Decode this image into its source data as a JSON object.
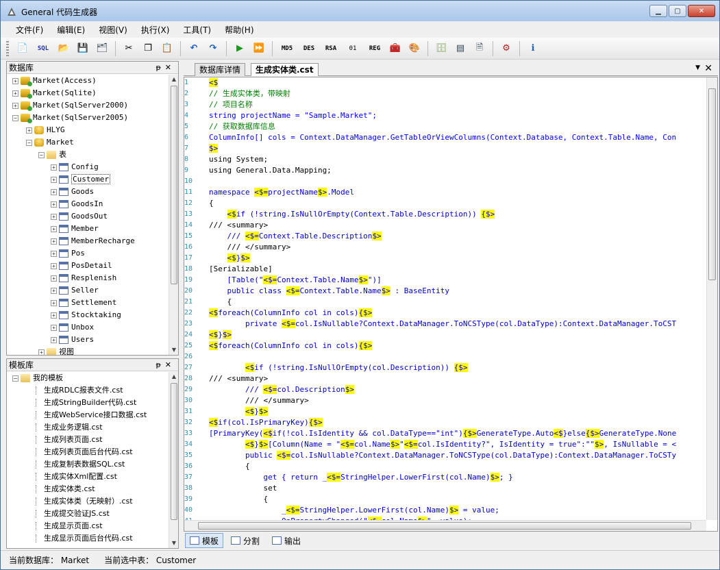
{
  "window": {
    "title": "General 代码生成器"
  },
  "menu": [
    "文件(F)",
    "编辑(E)",
    "视图(V)",
    "执行(X)",
    "工具(T)",
    "帮助(H)"
  ],
  "toolbar": {
    "md5": "MD5",
    "des": "DES",
    "rsa": "RSA",
    "bin": "01",
    "reg": "REG"
  },
  "db_panel": {
    "title": "数据库",
    "nodes": [
      "Market(Access)",
      "Market(Sqlite)",
      "Market(SqlServer2000)",
      "Market(SqlServer2005)",
      "HLYG",
      "Market",
      "表",
      "Config",
      "Customer",
      "Goods",
      "GoodsIn",
      "GoodsOut",
      "Member",
      "MemberRecharge",
      "Pos",
      "PosDetail",
      "Resplenish",
      "Seller",
      "Settlement",
      "Stocktaking",
      "Unbox",
      "Users",
      "视图"
    ]
  },
  "tpl_panel": {
    "title": "模板库",
    "root": "我的模板",
    "items": [
      "生成RDLC报表文件.cst",
      "生成StringBuilder代码.cst",
      "生成WebService接口数据.cst",
      "生成业务逻辑.cst",
      "生成列表页面.cst",
      "生成列表页面后台代码.cst",
      "生成复制表数据SQL.cst",
      "生成实体Xml配置.cst",
      "生成实体类.cst",
      "生成实体类（无映射）.cst",
      "生成提交验证JS.cst",
      "生成显示页面.cst",
      "生成显示页面后台代码.cst"
    ]
  },
  "editor": {
    "tabs": [
      "数据库详情",
      "生成实体类.cst"
    ],
    "lines": [
      "<$",
      "// 生成实体类，带映射",
      "// 项目名称",
      "string projectName = \"Sample.Market\";",
      "// 获取数据库信息",
      "ColumnInfo[] cols = Context.DataManager.GetTableOrViewColumns(Context.Database, Context.Table.Name, Con",
      "$>",
      "using System;",
      "using General.Data.Mapping;",
      "",
      "namespace <$=projectName$>.Model",
      "{",
      "    <$if (!string.IsNullOrEmpty(Context.Table.Description)) {$>",
      "/// <summary>",
      "    /// <$=Context.Table.Description$>",
      "    /// </summary>",
      "    <$}$>",
      "[Serializable]",
      "    [Table(\"<$=Context.Table.Name$>\")]",
      "    public class <$=Context.Table.Name$> : BaseEntity",
      "    {",
      "<$foreach(ColumnInfo col in cols){$>",
      "        private <$=col.IsNullable?Context.DataManager.ToNCSType(col.DataType):Context.DataManager.ToCST",
      "<$}$>",
      "<$foreach(ColumnInfo col in cols){$>",
      "",
      "        <$if (!string.IsNullOrEmpty(col.Description)) {$>",
      "/// <summary>",
      "        /// <$=col.Description$>",
      "        /// </summary>",
      "        <$}$>",
      "<$if(col.IsPrimaryKey){$>",
      "[PrimaryKey(<$if(!col.IsIdentity && col.DataType==\"int\"){$>GenerateType.Auto<$}else{$>GenerateType.None",
      "        <$}$>[Column(Name = \"<$=col.Name$>\"<$=col.IsIdentity?\", IsIdentity = true\":\"\"$>, IsNullable = <",
      "        public <$=col.IsNullable?Context.DataManager.ToNCSType(col.DataType):Context.DataManager.ToCSTy",
      "        {",
      "            get { return _<$=StringHelper.LowerFirst(col.Name)$>; }",
      "            set",
      "            {",
      "                _<$=StringHelper.LowerFirst(col.Name)$> = value;",
      "                OnPropertyChanged(\"<$=col.Name$>\", value);"
    ]
  },
  "bottom_tabs": [
    "模板",
    "分割",
    "输出"
  ],
  "status": {
    "db": "当前数据库： Market",
    "table": "当前选中表： Customer"
  }
}
